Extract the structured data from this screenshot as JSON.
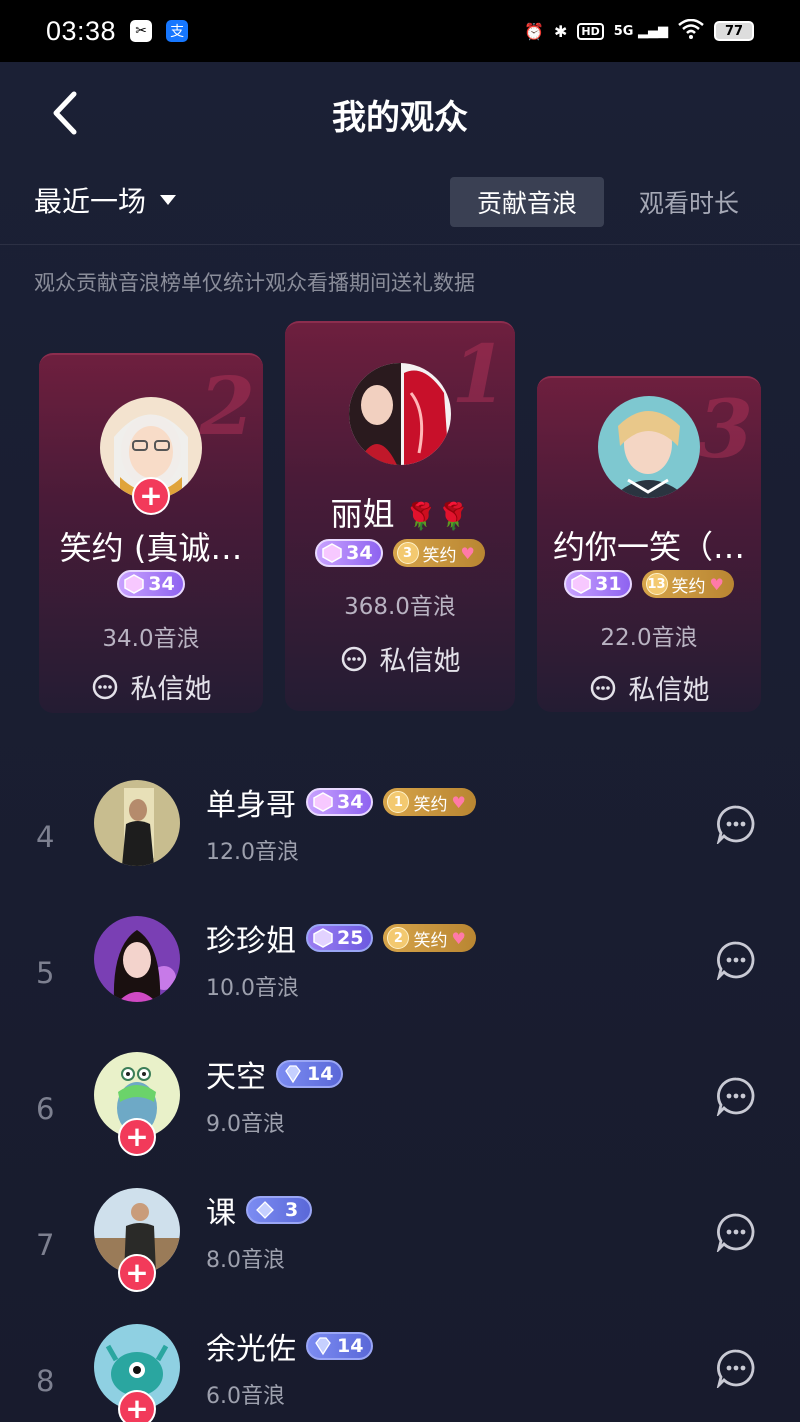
{
  "status_bar": {
    "time": "03:38",
    "network": "5G",
    "battery": "77",
    "icons": [
      "scanner-app-icon",
      "alipay-app-icon",
      "alarm-icon",
      "bluetooth-icon",
      "hd-icon",
      "signal-icon",
      "wifi-icon",
      "battery-icon"
    ]
  },
  "header": {
    "title": "我的观众",
    "back_icon": "chevron-left-icon"
  },
  "filter": {
    "label": "最近一场"
  },
  "tabs": [
    {
      "label": "贡献音浪",
      "active": true
    },
    {
      "label": "观看时长",
      "active": false
    }
  ],
  "note": "观众贡献音浪榜单仅统计观众看播期间送礼数据",
  "podium": [
    {
      "rank": "2",
      "name": "笑约 (真诚…",
      "level": "34",
      "fan_badge": null,
      "value": "34.0音浪",
      "message": "私信她",
      "follow": true
    },
    {
      "rank": "1",
      "name": "丽姐",
      "emoji": "🌹🌹",
      "level": "34",
      "fan_badge": {
        "level": "3",
        "label": "笑约"
      },
      "value": "368.0音浪",
      "message": "私信她",
      "follow": false
    },
    {
      "rank": "3",
      "name": "约你一笑（…",
      "level": "31",
      "fan_badge": {
        "level": "13",
        "label": "笑约"
      },
      "value": "22.0音浪",
      "message": "私信她",
      "follow": false
    }
  ],
  "list": [
    {
      "rank": "4",
      "name": "单身哥",
      "level": "34",
      "level_style": "purple",
      "fan_badge": {
        "level": "1",
        "label": "笑约"
      },
      "value": "12.0音浪",
      "follow": false
    },
    {
      "rank": "5",
      "name": "珍珍姐",
      "level": "25",
      "level_style": "purple",
      "fan_badge": {
        "level": "2",
        "label": "笑约"
      },
      "value": "10.0音浪",
      "follow": false
    },
    {
      "rank": "6",
      "name": "天空",
      "level": "14",
      "level_style": "blue",
      "fan_badge": null,
      "value": "9.0音浪",
      "follow": true
    },
    {
      "rank": "7",
      "name": "课",
      "level": "3",
      "level_style": "blue",
      "fan_badge": null,
      "value": "8.0音浪",
      "follow": true
    },
    {
      "rank": "8",
      "name": "余光佐",
      "level": "14",
      "level_style": "blue",
      "fan_badge": null,
      "value": "6.0音浪",
      "follow": true
    }
  ],
  "colors": {
    "background": "#171a2b",
    "card_accent": "#6e1f3e",
    "follow_badge": "#f23a5a",
    "fan_badge": "#d6a44a",
    "level_badge": "#8e63f0"
  }
}
